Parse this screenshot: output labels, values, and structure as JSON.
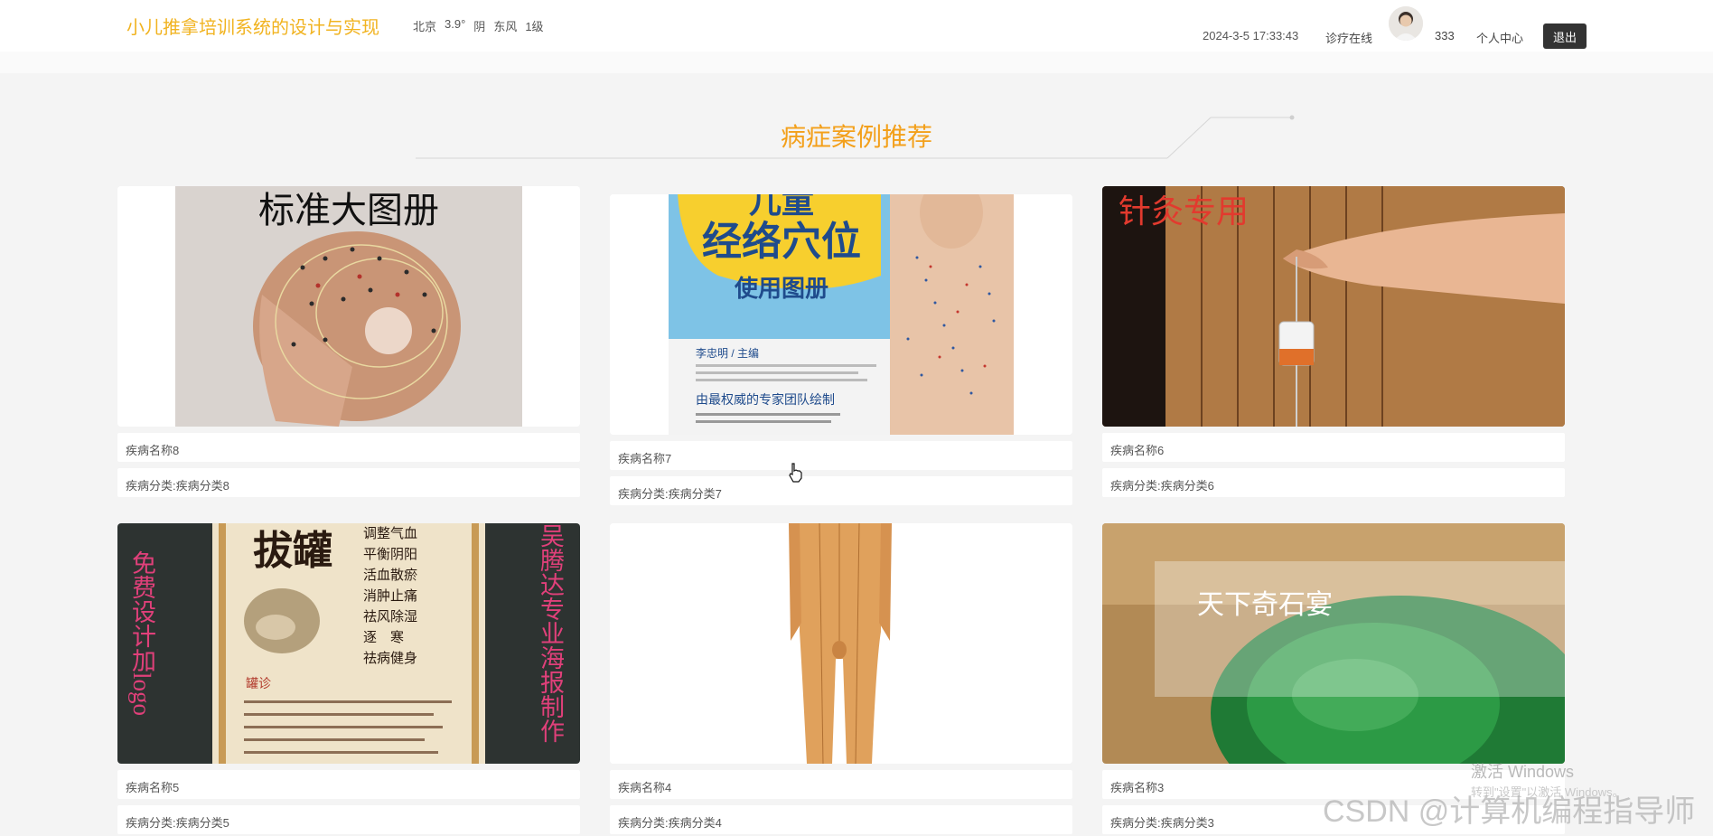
{
  "header": {
    "title": "小儿推拿培训系统的设计与实现",
    "weather": {
      "city": "北京",
      "temp": "3.9°",
      "condition": "阴",
      "wind": "东风",
      "level": "1级"
    },
    "datetime": "2024-3-5 17:33:43",
    "nav_online": "诊疗在线",
    "username": "333",
    "personal_center": "个人中心",
    "logout": "退出"
  },
  "section": {
    "title": "病症案例推荐"
  },
  "cards": [
    {
      "name": "疾病名称8",
      "category": "疾病分类:疾病分类8",
      "image": "acupoint-head-chart"
    },
    {
      "name": "疾病名称7",
      "category": "疾病分类:疾病分类7",
      "image": "child-meridian-book-cover"
    },
    {
      "name": "疾病名称6",
      "category": "疾病分类:疾病分类6",
      "image": "moxibustion-hand"
    },
    {
      "name": "疾病名称5",
      "category": "疾病分类:疾病分类5",
      "image": "cupping-poster"
    },
    {
      "name": "疾病名称4",
      "category": "疾病分类:疾病分类4",
      "image": "body-acupoint-model"
    },
    {
      "name": "疾病名称3",
      "category": "疾病分类:疾病分类3",
      "image": "jade-stone"
    }
  ],
  "images": {
    "card1": {
      "title": "标准大图册"
    },
    "card2": {
      "line1": "儿童",
      "line2": "经络穴位",
      "line3": "使用图册",
      "editor": "李忠明 / 主编",
      "footer": "由最权威的专家团队绘制"
    },
    "card3": {
      "side": "针灸专用"
    },
    "card4": {
      "left": "免费设计加logo",
      "right": "吴腾达专业海报制作",
      "badge": "拔罐",
      "list": [
        "调整气血",
        "平衡阴阳",
        "活血散瘀",
        "消肿止痛",
        "祛风除湿",
        "逐　寒",
        "祛病健身"
      ],
      "diag": "罐诊"
    },
    "card6": {
      "caption": "天下奇石宴"
    }
  },
  "watermarks": {
    "windows": "激活 Windows",
    "windows_sub": "转到\"设置\"以激活 Windows。",
    "csdn": "CSDN @计算机编程指导师"
  }
}
